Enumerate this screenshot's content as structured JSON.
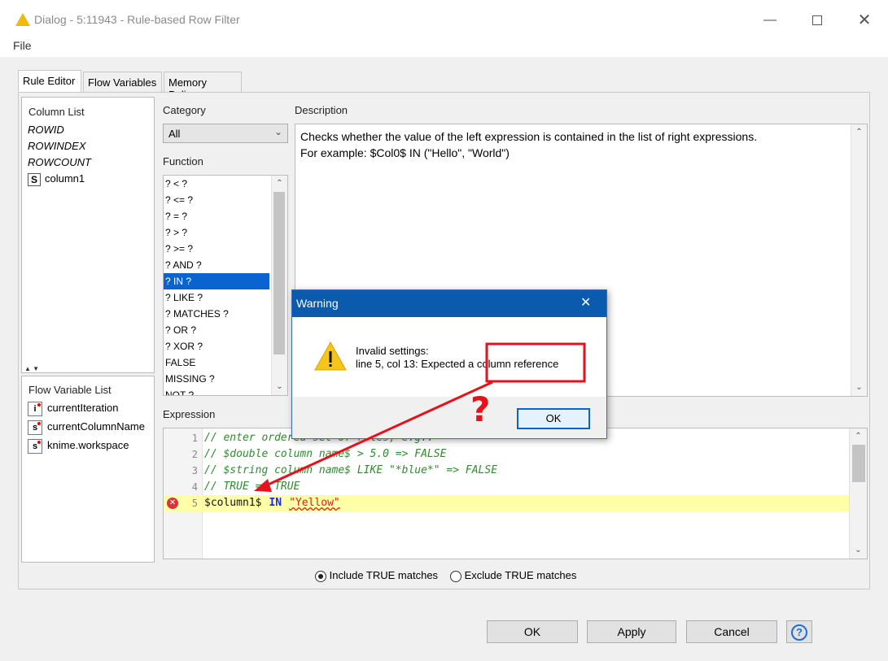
{
  "window": {
    "title": "Dialog - 5:11943 - Rule-based Row Filter",
    "minimize_icon": "minimize-icon",
    "maximize_icon": "maximize-icon",
    "close_icon": "close-icon"
  },
  "menu": {
    "file": "File"
  },
  "tabs": [
    {
      "label": "Rule Editor",
      "active": true
    },
    {
      "label": "Flow Variables"
    },
    {
      "label": "Memory Policy"
    }
  ],
  "column_list": {
    "title": "Column List",
    "items": [
      "ROWID",
      "ROWINDEX",
      "ROWCOUNT"
    ],
    "column_badge": "S",
    "column_name": "column1"
  },
  "flow_variable_list": {
    "title": "Flow Variable List",
    "items": [
      {
        "badge": "i",
        "name": "currentIteration"
      },
      {
        "badge": "s",
        "name": "currentColumnName"
      },
      {
        "badge": "s",
        "name": "knime.workspace"
      }
    ]
  },
  "category": {
    "label": "Category",
    "value": "All"
  },
  "function": {
    "label": "Function",
    "items": [
      "? < ?",
      "? <= ?",
      "? = ?",
      "? > ?",
      "? >= ?",
      "? AND ?",
      "? IN ?",
      "? LIKE ?",
      "? MATCHES ?",
      "? OR ?",
      "? XOR ?",
      "FALSE",
      "MISSING ?",
      "NOT ?"
    ],
    "selected_index": 6
  },
  "description": {
    "label": "Description",
    "line1": "Checks whether the value of the left expression is contained in the list of right expressions.",
    "line2": "For example: $Col0$ IN (\"Hello\", \"World\")"
  },
  "expression": {
    "label": "Expression",
    "lines": [
      {
        "num": "1",
        "text": "// enter ordered set of rules, e.g.:"
      },
      {
        "num": "2",
        "text": "// $double column name$ > 5.0 => FALSE"
      },
      {
        "num": "3",
        "text": "// $string column name$ LIKE \"*blue*\" => FALSE"
      },
      {
        "num": "4",
        "text": "// TRUE => TRUE"
      }
    ],
    "error_line": {
      "num": "5",
      "col": "$column1$",
      "op": "IN",
      "str": "\"Yellow\""
    }
  },
  "match_options": {
    "include": "Include TRUE matches",
    "exclude": "Exclude TRUE matches",
    "selected": "include"
  },
  "buttons": {
    "ok": "OK",
    "apply": "Apply",
    "cancel": "Cancel",
    "help": "?"
  },
  "warning": {
    "title": "Warning",
    "message_line1": "Invalid settings:",
    "message_line2": "line 5, col 13: Expected a column reference",
    "ok": "OK"
  },
  "annotation": {
    "mark": "?"
  },
  "colors": {
    "selection": "#0a64d0",
    "warning_titlebar": "#0a5aae",
    "annotation_red": "#e8101a",
    "code_comment": "#2e8b2e",
    "code_keyword": "#1a2fd8",
    "code_string": "#d82020",
    "error_line_bg": "#ffffa8"
  }
}
